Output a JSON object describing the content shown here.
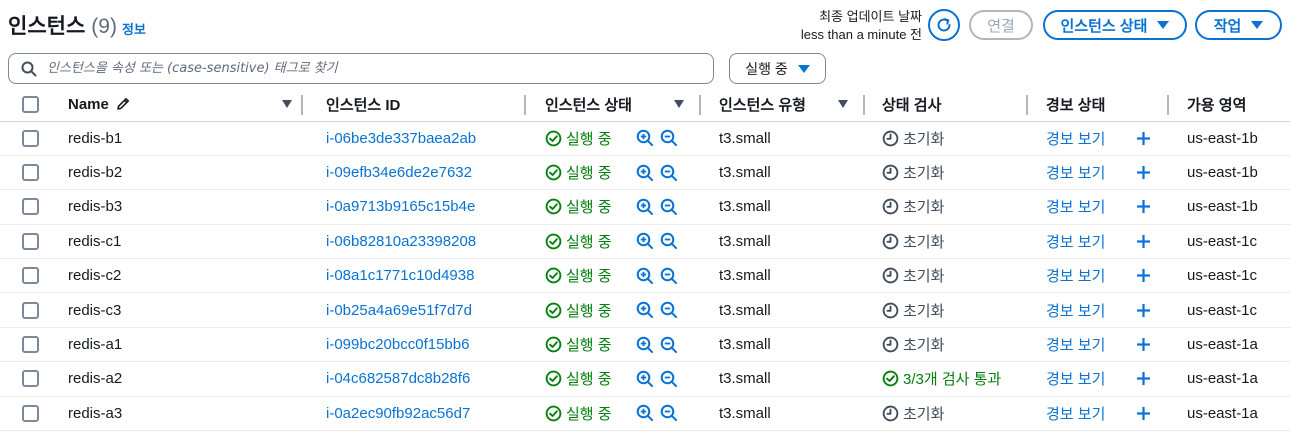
{
  "header": {
    "title": "인스턴스",
    "count": "(9)",
    "info_link": "정보",
    "last_update_label": "최종 업데이트 날짜",
    "last_update_value": "less than a minute 전",
    "connect_label": "연결",
    "instance_state_label": "인스턴스 상태",
    "actions_label": "작업"
  },
  "search": {
    "placeholder": "인스턴스을 속성 또는 (case-sensitive) 태그로 찾기"
  },
  "filter": {
    "selected": "실행 중"
  },
  "columns": {
    "name": "Name",
    "instance_id": "인스턴스 ID",
    "instance_state": "인스턴스 상태",
    "instance_type": "인스턴스 유형",
    "status_check": "상태 검사",
    "alarm_status": "경보 상태",
    "availability_zone": "가용 영역"
  },
  "colors": {
    "link": "#0972d3",
    "success": "#037f0c",
    "muted": "#414d5c"
  },
  "rows": [
    {
      "name": "redis-b1",
      "id": "i-06be3de337baea2ab",
      "state": "실행 중",
      "type": "t3.small",
      "check": "초기화",
      "check_ok": false,
      "alarm": "경보 보기",
      "zone": "us-east-1b"
    },
    {
      "name": "redis-b2",
      "id": "i-09efb34e6de2e7632",
      "state": "실행 중",
      "type": "t3.small",
      "check": "초기화",
      "check_ok": false,
      "alarm": "경보 보기",
      "zone": "us-east-1b"
    },
    {
      "name": "redis-b3",
      "id": "i-0a9713b9165c15b4e",
      "state": "실행 중",
      "type": "t3.small",
      "check": "초기화",
      "check_ok": false,
      "alarm": "경보 보기",
      "zone": "us-east-1b"
    },
    {
      "name": "redis-c1",
      "id": "i-06b82810a23398208",
      "state": "실행 중",
      "type": "t3.small",
      "check": "초기화",
      "check_ok": false,
      "alarm": "경보 보기",
      "zone": "us-east-1c"
    },
    {
      "name": "redis-c2",
      "id": "i-08a1c1771c10d4938",
      "state": "실행 중",
      "type": "t3.small",
      "check": "초기화",
      "check_ok": false,
      "alarm": "경보 보기",
      "zone": "us-east-1c"
    },
    {
      "name": "redis-c3",
      "id": "i-0b25a4a69e51f7d7d",
      "state": "실행 중",
      "type": "t3.small",
      "check": "초기화",
      "check_ok": false,
      "alarm": "경보 보기",
      "zone": "us-east-1c"
    },
    {
      "name": "redis-a1",
      "id": "i-099bc20bcc0f15bb6",
      "state": "실행 중",
      "type": "t3.small",
      "check": "초기화",
      "check_ok": false,
      "alarm": "경보 보기",
      "zone": "us-east-1a"
    },
    {
      "name": "redis-a2",
      "id": "i-04c682587dc8b28f6",
      "state": "실행 중",
      "type": "t3.small",
      "check": "3/3개 검사 통과",
      "check_ok": true,
      "alarm": "경보 보기",
      "zone": "us-east-1a"
    },
    {
      "name": "redis-a3",
      "id": "i-0a2ec90fb92ac56d7",
      "state": "실행 중",
      "type": "t3.small",
      "check": "초기화",
      "check_ok": false,
      "alarm": "경보 보기",
      "zone": "us-east-1a"
    }
  ]
}
